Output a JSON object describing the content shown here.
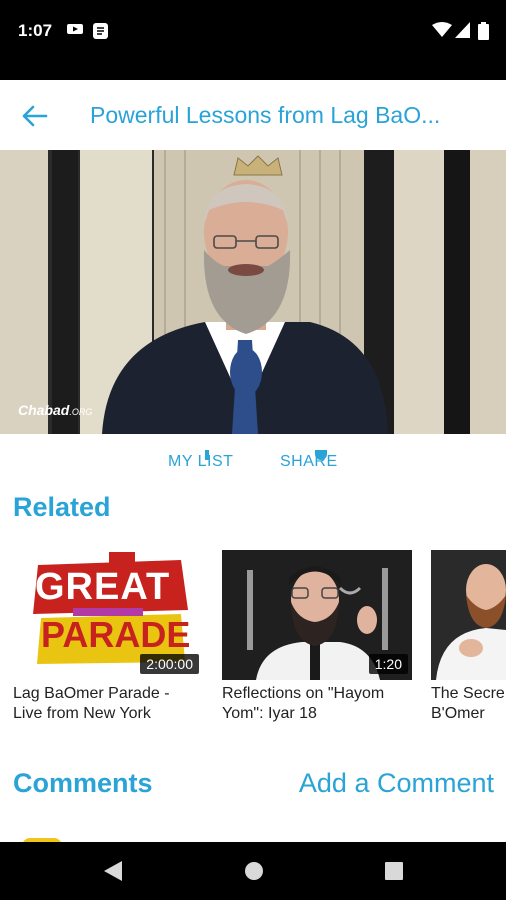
{
  "status_bar": {
    "time": "1:07"
  },
  "header": {
    "title": "Powerful Lessons from Lag BaO..."
  },
  "video": {
    "watermark": "Chabad",
    "watermark_suffix": ".ORG"
  },
  "actions": [
    {
      "label": "MY LIST"
    },
    {
      "label": "SHARE"
    }
  ],
  "related": {
    "title": "Related",
    "items": [
      {
        "caption": "Lag BaOmer Parade - Live from New York",
        "duration": "2:00:00",
        "thumb_text_1": "GREAT",
        "thumb_text_2": "PARADE"
      },
      {
        "caption": "Reflections on \"Hayom Yom\": Iyar 18",
        "duration": "1:20"
      },
      {
        "caption": "The Secre B'Omer",
        "duration": ""
      }
    ]
  },
  "comments": {
    "title": "Comments",
    "add_label": "Add a Comment"
  },
  "colors": {
    "accent": "#2aa3d6",
    "status_bar": "#000000",
    "nav_bar": "#000000"
  }
}
